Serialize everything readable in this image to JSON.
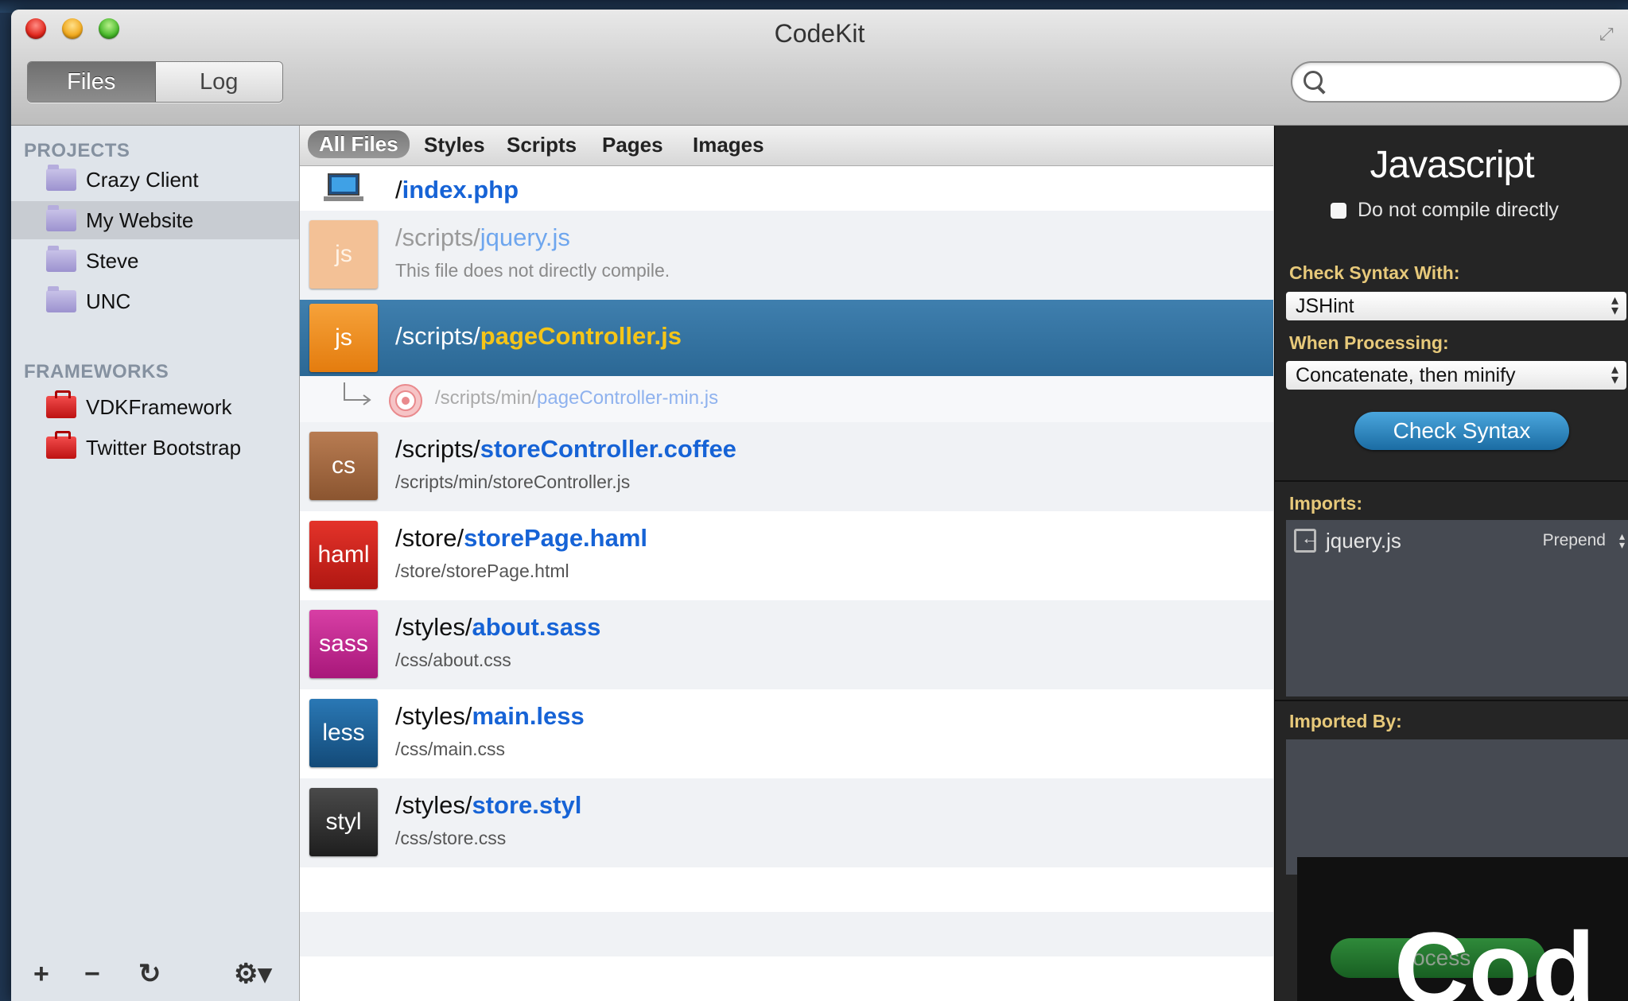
{
  "window": {
    "title": "CodeKit"
  },
  "toolbar": {
    "tabs": [
      "Files",
      "Log"
    ],
    "active_tab": "Files",
    "search_value": ""
  },
  "sidebar": {
    "projects_header": "PROJECTS",
    "projects": [
      "Crazy Client",
      "My Website",
      "Steve",
      "UNC"
    ],
    "selected_project": "My Website",
    "frameworks_header": "FRAMEWORKS",
    "frameworks": [
      "VDKFramework",
      "Twitter Bootstrap"
    ],
    "bottom_buttons": [
      "+",
      "−",
      "↻",
      "⚙▾"
    ]
  },
  "filters": {
    "items": [
      "All Files",
      "Styles",
      "Scripts",
      "Pages",
      "Images"
    ],
    "active": "All Files"
  },
  "files": [
    {
      "icon": "computer-icon",
      "path": "/",
      "name": "index.php"
    },
    {
      "badge": "js",
      "path": "/scripts/",
      "name": "jquery.js",
      "sub": "This file does not directly compile.",
      "color": "#f0b98a",
      "dimmed": true
    },
    {
      "badge": "js",
      "path": "/scripts/",
      "name": "pageController.js",
      "color": "#ee8b1e",
      "selected": true
    },
    {
      "child": true,
      "path": "/scripts/min/",
      "name": "pageController-min.js",
      "icon": "target-icon"
    },
    {
      "badge": "cs",
      "path": "/scripts/",
      "name": "storeController.coffee",
      "sub": "/scripts/min/storeController.js",
      "color": "#9a6238"
    },
    {
      "badge": "haml",
      "path": "/store/",
      "name": "storePage.haml",
      "sub": "/store/storePage.html",
      "color": "#c9201c"
    },
    {
      "badge": "sass",
      "path": "/styles/",
      "name": "about.sass",
      "sub": "/css/about.css",
      "color": "#c2208e"
    },
    {
      "badge": "less",
      "path": "/styles/",
      "name": "main.less",
      "sub": "/css/main.css",
      "color": "#1b5d92"
    },
    {
      "badge": "styl",
      "path": "/styles/",
      "name": "store.styl",
      "sub": "/css/store.css",
      "color": "#333333"
    }
  ],
  "panel": {
    "title": "Javascript",
    "no_compile_label": "Do not compile directly",
    "check_syntax_label": "Check Syntax With:",
    "check_syntax_value": "JSHint",
    "processing_label": "When Processing:",
    "processing_value": "Concatenate, then minify",
    "check_button": "Check Syntax",
    "imports_label": "Imports:",
    "imports": [
      {
        "name": "jquery.js",
        "mode": "Prepend"
      }
    ],
    "imported_by_label": "Imported By:",
    "process_button": "rocess",
    "overlay_text": "Cod"
  }
}
